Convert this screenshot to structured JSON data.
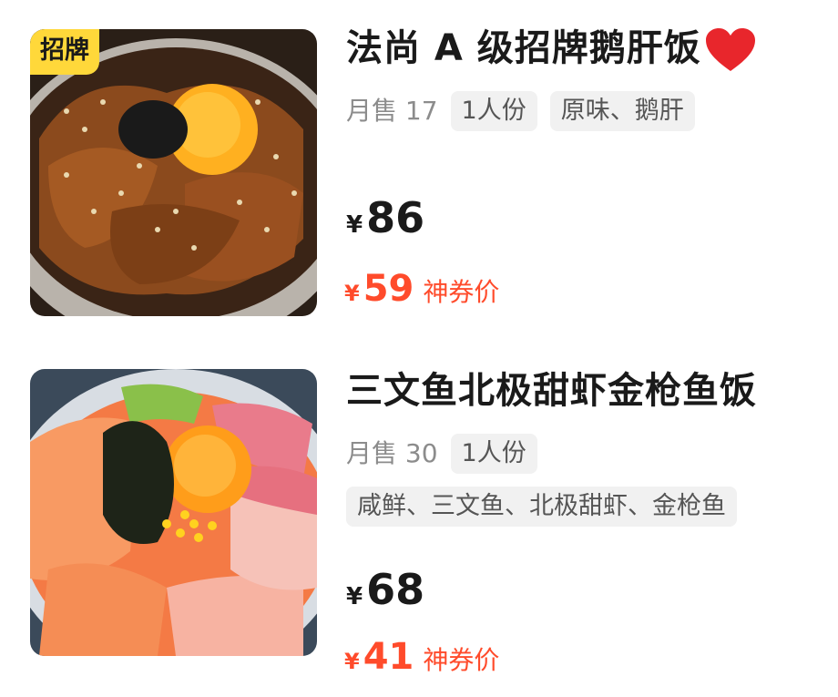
{
  "items": [
    {
      "badge": "招牌",
      "title": "法尚 A 级招牌鹅肝饭",
      "sales": "月售 17",
      "tags": [
        "1人份",
        "原味、鹅肝"
      ],
      "price": {
        "currency": "¥",
        "value": "86"
      },
      "deal": {
        "currency": "¥",
        "value": "59",
        "label": "神券价"
      },
      "icons": {
        "title_suffix": "heart-icon"
      }
    },
    {
      "title": "三文鱼北极甜虾金枪鱼饭",
      "sales": "月售 30",
      "tags": [
        "1人份"
      ],
      "tags_line2": [
        "咸鲜、三文鱼、北极甜虾、金枪鱼"
      ],
      "price": {
        "currency": "¥",
        "value": "68"
      },
      "deal": {
        "currency": "¥",
        "value": "41",
        "label": "神券价"
      }
    }
  ],
  "colors": {
    "deal": "#ff4b2b",
    "badge_bg": "#ffd83a",
    "tag_bg": "#f1f1f1",
    "heart": "#e8262c"
  }
}
